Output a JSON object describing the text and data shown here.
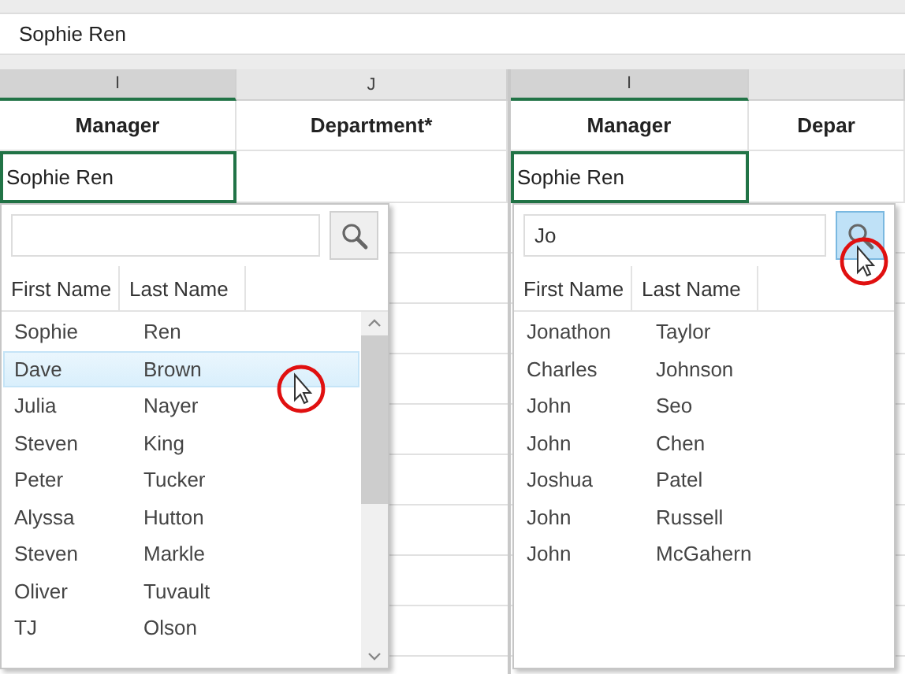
{
  "formula_bar": {
    "value": "Sophie Ren"
  },
  "panels": [
    {
      "columns": [
        {
          "letter": "I",
          "selected": true
        },
        {
          "letter": "J",
          "selected": false
        }
      ],
      "headers": [
        "Manager",
        "Department*"
      ],
      "active_cell": "Sophie Ren",
      "lookup": {
        "search_pressed": false,
        "columns": [
          "First Name",
          "Last Name"
        ],
        "scrollbar": true,
        "rows": [
          {
            "first": "Sophie",
            "last": "Ren",
            "selected": false
          },
          {
            "first": "Dave",
            "last": "Brown",
            "selected": true
          },
          {
            "first": "Julia",
            "last": "Nayer",
            "selected": false
          },
          {
            "first": "Steven",
            "last": "King",
            "selected": false
          },
          {
            "first": "Peter",
            "last": "Tucker",
            "selected": false
          },
          {
            "first": "Alyssa",
            "last": "Hutton",
            "selected": false
          },
          {
            "first": "Steven",
            "last": "Markle",
            "selected": false
          },
          {
            "first": "Oliver",
            "last": "Tuvault",
            "selected": false
          },
          {
            "first": "TJ",
            "last": "Olson",
            "selected": false
          }
        ]
      }
    },
    {
      "columns": [
        {
          "letter": "I",
          "selected": true
        },
        {
          "selected": false
        }
      ],
      "headers": [
        "Manager",
        "Depar"
      ],
      "active_cell": "Sophie Ren",
      "lookup": {
        "search_value": "Jo",
        "search_pressed": true,
        "columns": [
          "First Name",
          "Last Name"
        ],
        "rows": [
          {
            "first": "Jonathon",
            "last": "Taylor",
            "selected": false
          },
          {
            "first": "Charles",
            "last": "Johnson",
            "selected": false
          },
          {
            "first": "John",
            "last": "Seo",
            "selected": false
          },
          {
            "first": "John",
            "last": "Chen",
            "selected": false
          },
          {
            "first": "Joshua",
            "last": "Patel",
            "selected": false
          },
          {
            "first": "John",
            "last": "Russell",
            "selected": false
          },
          {
            "first": "John",
            "last": "McGahern",
            "selected": false
          }
        ]
      }
    }
  ]
}
